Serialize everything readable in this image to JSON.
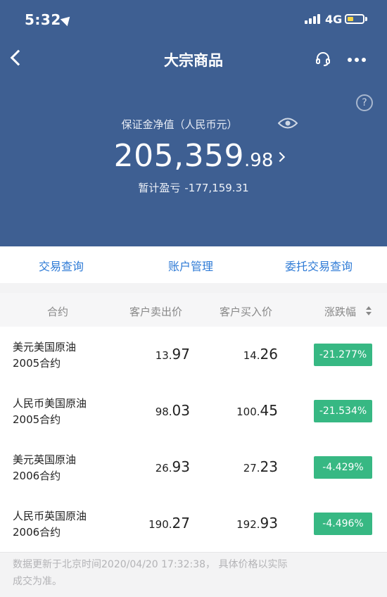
{
  "status_bar": {
    "time": "5:32",
    "network": "4G"
  },
  "nav": {
    "title": "大宗商品"
  },
  "summary": {
    "margin_label": "保证金净值（人民币元）",
    "balance_int": "205,359",
    "balance_dec": ".98",
    "pnl_label": "暂计盈亏",
    "pnl_value": "-177,159.31"
  },
  "actions": [
    "交易查询",
    "账户管理",
    "委托交易查询"
  ],
  "table": {
    "headers": [
      "合约",
      "客户卖出价",
      "客户买入价",
      "涨跌幅"
    ],
    "rows": [
      {
        "name1": "美元美国原油",
        "name2": "2005合约",
        "sell_int": "13.",
        "sell_dec": "97",
        "buy_int": "14.",
        "buy_dec": "26",
        "change": "-21.277%"
      },
      {
        "name1": "人民币美国原油",
        "name2": "2005合约",
        "sell_int": "98.",
        "sell_dec": "03",
        "buy_int": "100.",
        "buy_dec": "45",
        "change": "-21.534%"
      },
      {
        "name1": "美元英国原油",
        "name2": "2006合约",
        "sell_int": "26.",
        "sell_dec": "93",
        "buy_int": "27.",
        "buy_dec": "23",
        "change": "-4.429%"
      },
      {
        "name1": "人民币英国原油",
        "name2": "2006合约",
        "sell_int": "190.",
        "sell_dec": "27",
        "buy_int": "192.",
        "buy_dec": "93",
        "change": "-4.496%"
      }
    ]
  },
  "footer": {
    "line1": "数据更新于北京时间2020/04/20 17:32:38， 具体价格以实际",
    "line2": "成交为准。"
  },
  "colors": {
    "header_bg": "#3e5f92",
    "accent": "#2f7bd6",
    "change_bg": "#37b883"
  }
}
